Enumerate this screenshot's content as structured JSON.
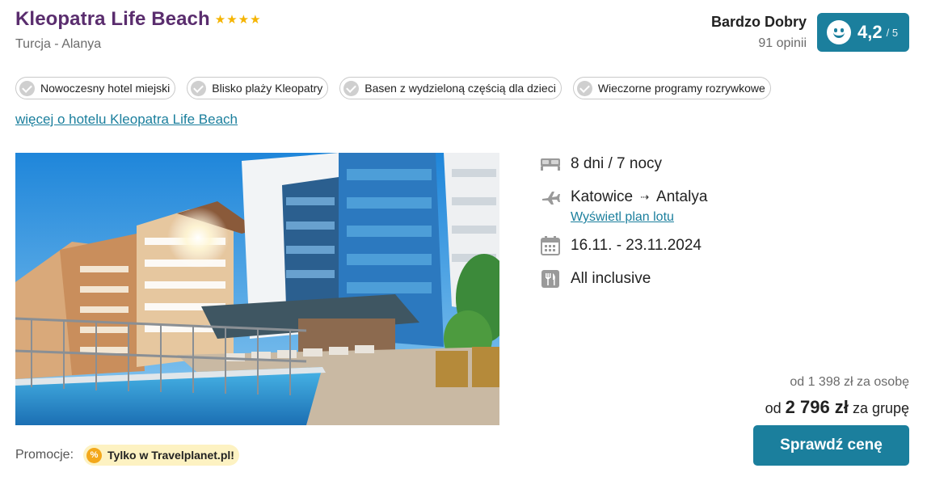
{
  "hotel": {
    "name": "Kleopatra Life Beach",
    "stars": 4,
    "location": "Turcja - Alanya"
  },
  "rating": {
    "label": "Bardzo Dobry",
    "count": "91 opinii",
    "score": "4,2",
    "max": "/ 5",
    "icon": "smiley-icon",
    "color": "#1b7f9d"
  },
  "tags": [
    {
      "label": "Nowoczesny hotel miejski"
    },
    {
      "label": "Blisko plaży Kleopatry"
    },
    {
      "label": "Basen z wydzieloną częścią dla dzieci"
    },
    {
      "label": "Wieczorne programy rozrywkowe"
    }
  ],
  "more_link": "więcej o hotelu Kleopatra Life Beach",
  "details": {
    "duration": "8 dni / 7 nocy",
    "from": "Katowice",
    "to": "Antalya",
    "flight_link": "Wyświetl plan lotu",
    "dates": "16.11. - 23.11.2024",
    "board": "All inclusive"
  },
  "price": {
    "per_person": "od 1 398 zł za osobę",
    "group_prefix": "od",
    "group_amount": "2 796 zł",
    "group_suffix": "za grupę",
    "cta": "Sprawdź cenę"
  },
  "promo": {
    "label": "Promocje:",
    "badge": "Tylko w Travelplanet.pl!",
    "icon": "percent-icon"
  },
  "colors": {
    "brand_title": "#5a2d6e",
    "accent": "#1b7f9d",
    "star": "#f5b400",
    "promo_bg": "#fdf2c2"
  }
}
